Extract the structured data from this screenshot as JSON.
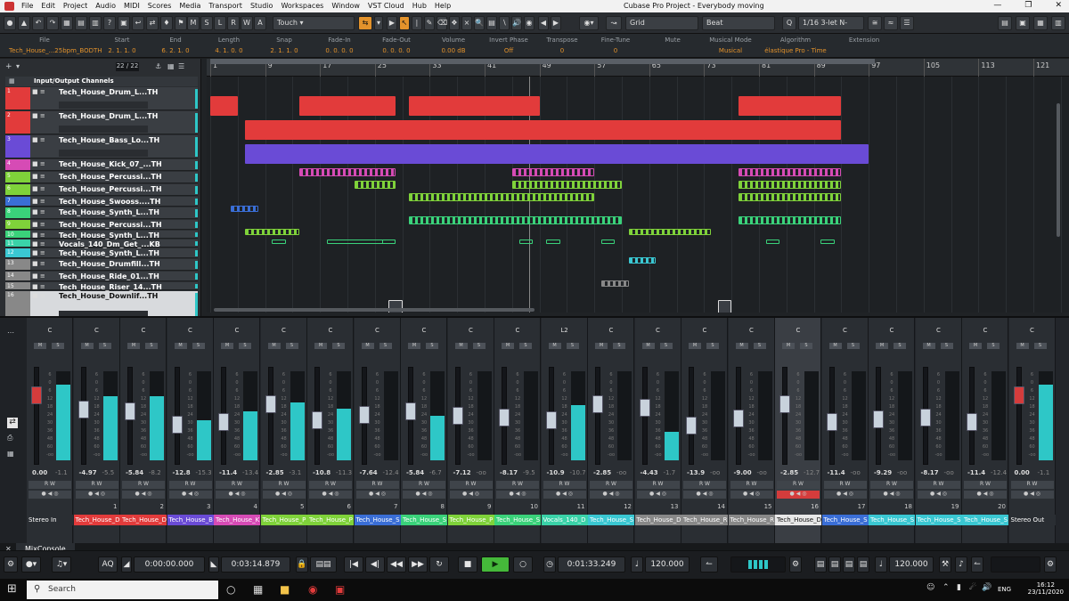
{
  "window": {
    "title": "Cubase Pro Project - Everybody moving",
    "menu": [
      "File",
      "Edit",
      "Project",
      "Audio",
      "MIDI",
      "Scores",
      "Media",
      "Transport",
      "Studio",
      "Workspaces",
      "Window",
      "VST Cloud",
      "Hub",
      "Help"
    ]
  },
  "toolbar": {
    "mode_buttons": [
      "M",
      "S",
      "L",
      "R",
      "W",
      "A"
    ],
    "automation_mode": "Touch",
    "snap_type": "Grid",
    "grid_value": "Beat",
    "quantize": "1/16 3-let N-"
  },
  "infoline": {
    "fields": [
      {
        "label": "File",
        "value": "Tech_House_...25bpm_BODTH"
      },
      {
        "label": "Start",
        "value": "2. 1. 1.   0"
      },
      {
        "label": "End",
        "value": "6. 2. 1.   0"
      },
      {
        "label": "Length",
        "value": "4. 1. 0.   0"
      },
      {
        "label": "Snap",
        "value": "2. 1. 1.   0"
      },
      {
        "label": "Fade-In",
        "value": "0. 0. 0.   0"
      },
      {
        "label": "Fade-Out",
        "value": "0. 0. 0.   0"
      },
      {
        "label": "Volume",
        "value": "0.00   dB"
      },
      {
        "label": "Invert Phase",
        "value": "Off"
      },
      {
        "label": "Transpose",
        "value": "0"
      },
      {
        "label": "Fine-Tune",
        "value": "0"
      },
      {
        "label": "Mute",
        "value": ""
      },
      {
        "label": "Musical Mode",
        "value": "Musical"
      },
      {
        "label": "Algorithm",
        "value": "élastique Pro - Time"
      },
      {
        "label": "Extension",
        "value": ""
      }
    ]
  },
  "project": {
    "track_count": "22 / 22",
    "folder_label": "Input/Output Channels",
    "tracks": [
      {
        "name": "Tech_House_Drum_L...TH",
        "num": "1",
        "color": "#e23b3b",
        "h": 26
      },
      {
        "name": "Tech_House_Drum_L...TH",
        "num": "2",
        "color": "#e23b3b",
        "h": 26
      },
      {
        "name": "Tech_House_Bass_Lo...TH",
        "num": "3",
        "color": "#6a4bd6",
        "h": 26
      },
      {
        "name": "Tech_House_Kick_07_...TH",
        "num": "4",
        "color": "#d64bb5",
        "h": 13
      },
      {
        "name": "Tech_House_Percussi...TH",
        "num": "5",
        "color": "#7fd23a",
        "h": 13
      },
      {
        "name": "Tech_House_Percussi...TH",
        "num": "6",
        "color": "#7fd23a",
        "h": 13
      },
      {
        "name": "Tech_House_Swooss....TH",
        "num": "7",
        "color": "#3a6ed6",
        "h": 11
      },
      {
        "name": "Tech_House_Synth_L...TH",
        "num": "8",
        "color": "#3ad27a",
        "h": 13
      },
      {
        "name": "Tech_House_Percussi...TH",
        "num": "9",
        "color": "#7fd23a",
        "h": 11
      },
      {
        "name": "Tech_House_Synth_L...TH",
        "num": "10",
        "color": "#3ad27a",
        "h": 9
      },
      {
        "name": "Vocals_140_Dm_Get_...KB",
        "num": "11",
        "color": "#3ad2a8",
        "h": 9
      },
      {
        "name": "Tech_House_Synth_L...TH",
        "num": "12",
        "color": "#3ac7d2",
        "h": 11
      },
      {
        "name": "Tech_House_Drumfill...TH",
        "num": "13",
        "color": "#888888",
        "h": 13
      },
      {
        "name": "Tech_House_Ride_01...TH",
        "num": "14",
        "color": "#888888",
        "h": 11
      },
      {
        "name": "Tech_House_Riser_14...TH",
        "num": "15",
        "color": "#888888",
        "h": 9
      },
      {
        "name": "Tech_House_Downlif...TH",
        "num": "16",
        "color": "#888888",
        "h": 32
      }
    ],
    "ruler": [
      "1",
      "9",
      "17",
      "25",
      "33",
      "41",
      "49",
      "57",
      "65",
      "73",
      "81",
      "89",
      "97",
      "105",
      "113",
      "121"
    ]
  },
  "mixer": {
    "tab_label": "MixConsole",
    "channels": [
      {
        "name": "Stereo In",
        "num": "",
        "pan": "C",
        "db": "0.00",
        "peak": "-1.1",
        "level": 0.85,
        "fader": 0.78,
        "color": "#2a2e33",
        "red": true
      },
      {
        "name": "Tech_House_D",
        "num": "1",
        "pan": "C",
        "db": "-4.97",
        "peak": "-5.5",
        "level": 0.72,
        "fader": 0.62,
        "color": "#e23b3b"
      },
      {
        "name": "Tech_House_D",
        "num": "2",
        "pan": "C",
        "db": "-5.84",
        "peak": "-8.2",
        "level": 0.72,
        "fader": 0.6,
        "color": "#e23b3b"
      },
      {
        "name": "Tech_House_B",
        "num": "3",
        "pan": "C",
        "db": "-12.8",
        "peak": "-15.3",
        "level": 0.45,
        "fader": 0.45,
        "color": "#6a4bd6"
      },
      {
        "name": "Tech_House_K",
        "num": "4",
        "pan": "C",
        "db": "-11.4",
        "peak": "-13.4",
        "level": 0.55,
        "fader": 0.48,
        "color": "#d64bb5"
      },
      {
        "name": "Tech_House_P",
        "num": "5",
        "pan": "C",
        "db": "-2.85",
        "peak": "-3.1",
        "level": 0.65,
        "fader": 0.68,
        "color": "#7fd23a"
      },
      {
        "name": "Tech_House_P",
        "num": "6",
        "pan": "C",
        "db": "-10.8",
        "peak": "-11.3",
        "level": 0.58,
        "fader": 0.5,
        "color": "#7fd23a"
      },
      {
        "name": "Tech_House_S",
        "num": "7",
        "pan": "C",
        "db": "-7.64",
        "peak": "-12.4",
        "level": 0,
        "fader": 0.56,
        "color": "#3a6ed6"
      },
      {
        "name": "Tech_House_S",
        "num": "8",
        "pan": "C",
        "db": "-5.84",
        "peak": "-6.7",
        "level": 0.5,
        "fader": 0.6,
        "color": "#3ad27a"
      },
      {
        "name": "Tech_House_P",
        "num": "9",
        "pan": "C",
        "db": "-7.12",
        "peak": "-oo",
        "level": 0,
        "fader": 0.55,
        "color": "#7fd23a"
      },
      {
        "name": "Tech_House_S",
        "num": "10",
        "pan": "C",
        "db": "-8.17",
        "peak": "-9.5",
        "level": 0,
        "fader": 0.53,
        "color": "#3ad27a"
      },
      {
        "name": "Vocals_140_D",
        "num": "11",
        "pan": "L2",
        "db": "-10.9",
        "peak": "-10.7",
        "level": 0.62,
        "fader": 0.5,
        "color": "#3ad2a8"
      },
      {
        "name": "Tech_House_S",
        "num": "12",
        "pan": "C",
        "db": "-2.85",
        "peak": "-oo",
        "level": 0,
        "fader": 0.68,
        "color": "#3ac7d2"
      },
      {
        "name": "Tech_House_D",
        "num": "13",
        "pan": "C",
        "db": "-4.43",
        "peak": "-1.7",
        "level": 0.32,
        "fader": 0.64,
        "color": "#888888"
      },
      {
        "name": "Tech_House_R",
        "num": "14",
        "pan": "C",
        "db": "-13.9",
        "peak": "-oo",
        "level": 0,
        "fader": 0.44,
        "color": "#888888"
      },
      {
        "name": "Tech_House_R",
        "num": "15",
        "pan": "C",
        "db": "-9.00",
        "peak": "-oo",
        "level": 0,
        "fader": 0.52,
        "color": "#888888"
      },
      {
        "name": "Tech_House_D",
        "num": "16",
        "pan": "C",
        "db": "-2.85",
        "peak": "-12.7",
        "level": 0,
        "fader": 0.68,
        "color": "#e8e8e8",
        "sel": true
      },
      {
        "name": "Tech_House_S",
        "num": "17",
        "pan": "C",
        "db": "-11.4",
        "peak": "-oo",
        "level": 0,
        "fader": 0.48,
        "color": "#3a6ed6"
      },
      {
        "name": "Tech_House_S",
        "num": "18",
        "pan": "C",
        "db": "-9.29",
        "peak": "-oo",
        "level": 0,
        "fader": 0.51,
        "color": "#3ac7d2"
      },
      {
        "name": "Tech_House_S",
        "num": "19",
        "pan": "C",
        "db": "-8.17",
        "peak": "-oo",
        "level": 0,
        "fader": 0.53,
        "color": "#3ac7d2"
      },
      {
        "name": "Tech_House_S",
        "num": "20",
        "pan": "C",
        "db": "-11.4",
        "peak": "-12.4",
        "level": 0,
        "fader": 0.48,
        "color": "#3ac7d2"
      },
      {
        "name": "Stereo Out",
        "num": "",
        "pan": "C",
        "db": "0.00",
        "peak": "-1.1",
        "level": 0.85,
        "fader": 0.78,
        "color": "#2a2e33",
        "red": true
      }
    ]
  },
  "transport": {
    "left_locator": "0:00:00.000",
    "right_locator": "0:03:14.879",
    "position": "0:01:33.249",
    "tempo": "120.000",
    "tempo_right": "120.000",
    "aq_label": "AQ"
  },
  "taskbar": {
    "search_placeholder": "Search",
    "time": "16:12",
    "date": "23/11/2020",
    "lang": "ENG"
  }
}
